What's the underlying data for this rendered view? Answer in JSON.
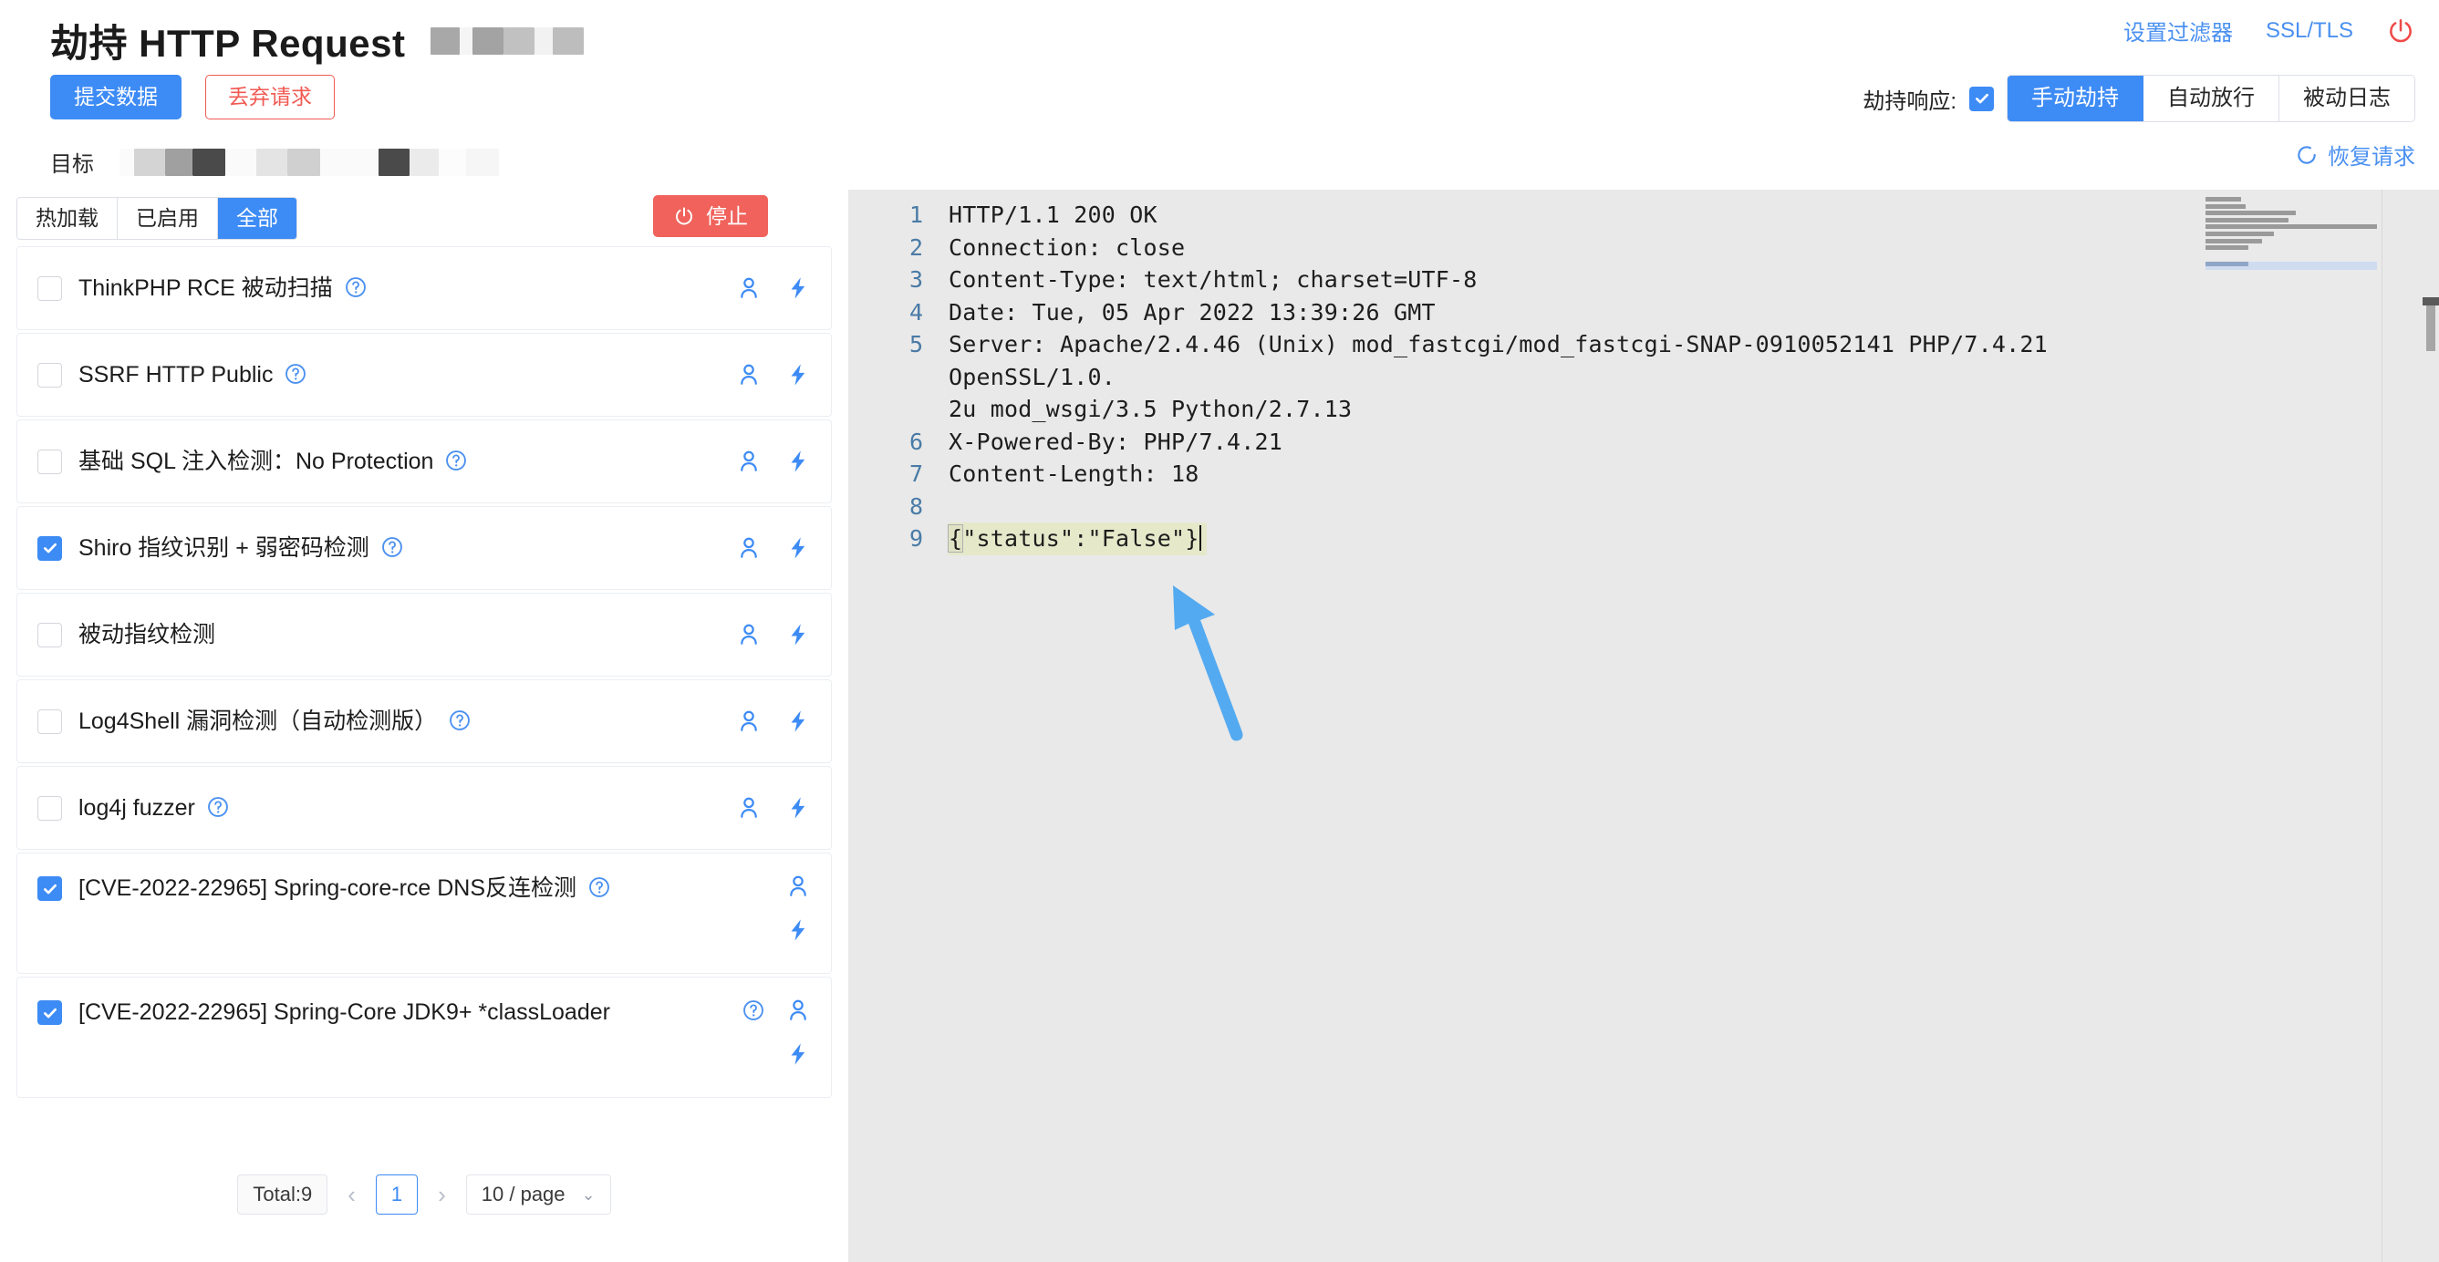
{
  "header": {
    "title": "劫持 HTTP Request",
    "title_redactions": [
      {
        "width": 32,
        "color": "#a8a8a8"
      },
      {
        "width": 14,
        "color": "#f5f5f5"
      },
      {
        "width": 34,
        "color": "#a3a3a3"
      },
      {
        "width": 34,
        "color": "#c1c1c1"
      },
      {
        "width": 20,
        "color": "#f2f2f2"
      },
      {
        "width": 34,
        "color": "#bdbdbd"
      }
    ],
    "submit_label": "提交数据",
    "discard_label": "丢弃请求",
    "target_label": "目标",
    "target_redactions": [
      {
        "width": 16,
        "color": "#fbfbfb"
      },
      {
        "width": 34,
        "color": "#d4d4d4"
      },
      {
        "width": 30,
        "color": "#a0a0a0"
      },
      {
        "width": 36,
        "color": "#4a4a4a"
      },
      {
        "width": 34,
        "color": "#fafafa"
      },
      {
        "width": 34,
        "color": "#e4e4e4"
      },
      {
        "width": 36,
        "color": "#d0d0d0"
      },
      {
        "width": 64,
        "color": "#fafafa"
      },
      {
        "width": 34,
        "color": "#4a4a4a"
      },
      {
        "width": 32,
        "color": "#ebebeb"
      },
      {
        "width": 30,
        "color": "#fcfcfc"
      },
      {
        "width": 36,
        "color": "#f6f6f6"
      }
    ],
    "filter_link": "设置过滤器",
    "ssl_link": "SSL/TLS",
    "power_icon": "power-icon",
    "intercept_label": "劫持响应:",
    "intercept_checked": true,
    "modes": [
      {
        "label": "手动劫持",
        "active": true
      },
      {
        "label": "自动放行",
        "active": false
      },
      {
        "label": "被动日志",
        "active": false
      }
    ],
    "restore_label": "恢复请求",
    "restore_icon": "refresh-icon"
  },
  "colors": {
    "accent": "#3d8bf5",
    "link": "#4a90f0",
    "danger": "#f15a53",
    "stop": "#f0625b",
    "editor_bg": "#e9e9e9",
    "line_number": "#4a7ba6",
    "active_line": "#e5e9ca",
    "arrow": "#54aaf0"
  },
  "sidebar": {
    "tabs": [
      {
        "label": "热加载",
        "active": false
      },
      {
        "label": "已启用",
        "active": false
      },
      {
        "label": "全部",
        "active": true
      }
    ],
    "stop_label": "停止",
    "stop_icon": "power-icon",
    "plugins": [
      {
        "label": "ThinkPHP RCE 被动扫描",
        "checked": false,
        "has_help": true,
        "stacked": false,
        "tall": false
      },
      {
        "label": "SSRF HTTP Public",
        "checked": false,
        "has_help": true,
        "stacked": false,
        "tall": false
      },
      {
        "label": "基础 SQL 注入检测：No Protection",
        "checked": false,
        "has_help": true,
        "stacked": false,
        "tall": false
      },
      {
        "label": "Shiro 指纹识别 + 弱密码检测",
        "checked": true,
        "has_help": true,
        "stacked": false,
        "tall": false
      },
      {
        "label": "被动指纹检测",
        "checked": false,
        "has_help": false,
        "stacked": false,
        "tall": false
      },
      {
        "label": "Log4Shell 漏洞检测（自动检测版）",
        "checked": false,
        "has_help": true,
        "stacked": false,
        "tall": false
      },
      {
        "label": "log4j fuzzer",
        "checked": false,
        "has_help": true,
        "stacked": false,
        "tall": false
      },
      {
        "label": "[CVE-2022-22965] Spring-core-rce DNS反连检测",
        "checked": true,
        "has_help": true,
        "stacked": true,
        "tall": true
      },
      {
        "label": "[CVE-2022-22965] Spring-Core JDK9+ *classLoader",
        "checked": true,
        "has_help": true,
        "help_first": true,
        "stacked": true,
        "tall": true
      }
    ],
    "icons": {
      "help": "help-circle-icon",
      "user": "user-icon",
      "bolt": "lightning-bolt-icon"
    },
    "pagination": {
      "total_label": "Total:9",
      "prev": "‹",
      "current_page": "1",
      "next": "›",
      "page_size": "10 / page",
      "chevron": "chevron-down-icon"
    }
  },
  "editor": {
    "lines": [
      {
        "num": "1",
        "text": "HTTP/1.1 200 OK",
        "active": false,
        "wrapped": null
      },
      {
        "num": "2",
        "text": "Connection: close",
        "active": false,
        "wrapped": null
      },
      {
        "num": "3",
        "text": "Content-Type: text/html; charset=UTF-8",
        "active": false,
        "wrapped": null
      },
      {
        "num": "4",
        "text": "Date: Tue, 05 Apr 2022 13:39:26 GMT",
        "active": false,
        "wrapped": null
      },
      {
        "num": "5",
        "text": "Server: Apache/2.4.46 (Unix) mod_fastcgi/mod_fastcgi-SNAP-0910052141 PHP/7.4.21 OpenSSL/1.0.",
        "active": false,
        "wrapped": "2u mod_wsgi/3.5 Python/2.7.13"
      },
      {
        "num": "6",
        "text": "X-Powered-By: PHP/7.4.21",
        "active": false,
        "wrapped": null
      },
      {
        "num": "7",
        "text": "Content-Length: 18",
        "active": false,
        "wrapped": null
      },
      {
        "num": "8",
        "text": "",
        "active": false,
        "wrapped": null
      },
      {
        "num": "9",
        "text": "{\"status\":\"False\"}",
        "active": true,
        "wrapped": null
      }
    ],
    "active_line_body": "{\"status\":\"False\"}",
    "annotation_arrow": "up-left-arrow"
  }
}
